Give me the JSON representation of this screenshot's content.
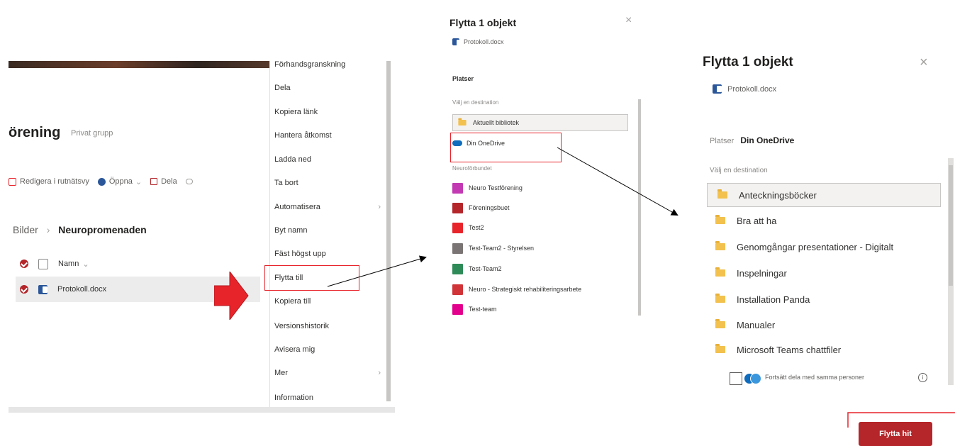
{
  "panel1": {
    "group_title": "örening",
    "group_type": "Privat grupp",
    "commands": [
      {
        "label": "Redigera i rutnätsvy",
        "color": "#e8242b",
        "icon": "grid-edit-icon"
      },
      {
        "label": "Öppna",
        "color": "#2b579a",
        "icon": "open-icon",
        "chevron": "⌄"
      },
      {
        "label": "Dela",
        "color": "#b4262a",
        "icon": "share-icon"
      },
      {
        "label": "",
        "color": "#8a8886",
        "icon": "copy-link-icon"
      }
    ],
    "breadcrumb": {
      "parent": "Bilder",
      "separator": "›",
      "current": "Neuropromenaden"
    },
    "header_row": {
      "column": "Namn",
      "chevron": "⌄"
    },
    "file_row": {
      "name": "Protokoll.docx"
    },
    "context_menu": [
      {
        "label": "Förhandsgranskning"
      },
      {
        "label": "Dela"
      },
      {
        "label": "Kopiera länk"
      },
      {
        "label": "Hantera åtkomst"
      },
      {
        "label": "Ladda ned"
      },
      {
        "label": "Ta bort"
      },
      {
        "label": "Automatisera",
        "chevron": "›"
      },
      {
        "label": "Byt namn"
      },
      {
        "label": "Fäst högst upp"
      },
      {
        "label": "Flytta till"
      },
      {
        "label": "Kopiera till"
      },
      {
        "label": "Versionshistorik"
      },
      {
        "label": "Avisera mig"
      },
      {
        "label": "Mer",
        "chevron": "›"
      },
      {
        "label": "Information"
      }
    ]
  },
  "panel2": {
    "title": "Flytta 1 objekt",
    "close": "×",
    "file": "Protokoll.docx",
    "places_label": "Platser",
    "choose_label": "Välj en destination",
    "current_library": "Aktuellt bibliotek",
    "onedrive": "Din OneDrive",
    "section_label": "Neuroförbundet",
    "items": [
      {
        "label": "Neuro Testförening",
        "color": "#c239b3"
      },
      {
        "label": "Föreningsbuet",
        "color": "#b4262a"
      },
      {
        "label": "Test2",
        "color": "#e8242b"
      },
      {
        "label": "Test-Team2 - Styrelsen",
        "color": "#7a7574"
      },
      {
        "label": "Test-Team2",
        "color": "#2e8b57"
      },
      {
        "label": "Neuro - Strategiskt rehabiliteringsarbete",
        "color": "#d13438"
      },
      {
        "label": "Test-team",
        "color": "#e3008c"
      }
    ]
  },
  "panel3": {
    "title": "Flytta 1 objekt",
    "close": "×",
    "file": "Protokoll.docx",
    "places_label": "Platser",
    "places_value": "Din OneDrive",
    "choose_label": "Välj en destination",
    "folders": [
      "Anteckningsböcker",
      "Bra att ha",
      "Genomgångar presentationer - Digitalt",
      "Inspelningar",
      "Installation Panda",
      "Manualer",
      "Microsoft Teams chattfiler"
    ],
    "keep_sharing": "Fortsätt dela med samma personer",
    "info": "i",
    "move_button": "Flytta hit"
  },
  "colors": {
    "accent": "#b4262a",
    "highlight_box": "#e8242b",
    "big_arrow": "#e8242b"
  }
}
